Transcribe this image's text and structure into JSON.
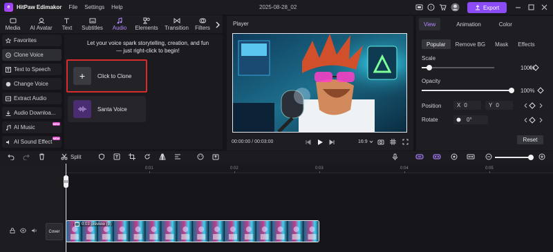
{
  "app": {
    "name": "HitPaw Edimakor",
    "logo_text": "e",
    "project_name": "2025-08-28_02"
  },
  "menu": [
    "File",
    "Settings",
    "Help"
  ],
  "toolbar": {
    "export_label": "Export"
  },
  "media_tabs": [
    {
      "label": "Media",
      "icon": "media-icon",
      "active": false
    },
    {
      "label": "AI Avatar",
      "icon": "ai-avatar-icon",
      "active": false
    },
    {
      "label": "Text",
      "icon": "text-icon",
      "active": false
    },
    {
      "label": "Subtitles",
      "icon": "subtitles-icon",
      "active": false
    },
    {
      "label": "Audio",
      "icon": "music-note-icon",
      "active": true
    },
    {
      "label": "Elements",
      "icon": "elements-icon",
      "active": false
    },
    {
      "label": "Transition",
      "icon": "transition-icon",
      "active": false
    },
    {
      "label": "Filters",
      "icon": "filters-icon",
      "active": false
    }
  ],
  "left_nav": [
    {
      "label": "Favorites",
      "icon": "star-icon",
      "active": false,
      "badge": ""
    },
    {
      "label": "Clone Voice",
      "icon": "clone-voice-icon",
      "active": true,
      "badge": ""
    },
    {
      "label": "Text to Speech",
      "icon": "text-to-speech-icon",
      "active": false,
      "badge": ""
    },
    {
      "label": "Change Voice",
      "icon": "change-voice-icon",
      "active": false,
      "badge": ""
    },
    {
      "label": "Extract Audio",
      "icon": "extract-audio-icon",
      "active": false,
      "badge": ""
    },
    {
      "label": "Audio Downloa...",
      "icon": "download-icon",
      "active": false,
      "badge": ""
    },
    {
      "label": "AI Music",
      "icon": "ai-music-icon",
      "active": false,
      "badge": "NEW"
    },
    {
      "label": "AI Sound Effect",
      "icon": "sound-effect-icon",
      "active": false,
      "badge": "NEW"
    }
  ],
  "clone_panel": {
    "intro_line1": "Let your voice spark storytelling, creation, and fun",
    "intro_line2": "— just right-click to begin!",
    "clone_card_label": "Click to Clone",
    "voices": [
      {
        "label": "Santa Voice"
      }
    ]
  },
  "player": {
    "title": "Player",
    "time_current": "00:00:00",
    "time_separator": "/",
    "time_total": "00:03:00",
    "aspect_ratio": "16:9"
  },
  "props": {
    "tabs": [
      {
        "label": "View",
        "active": true
      },
      {
        "label": "Animation",
        "active": false
      },
      {
        "label": "Color",
        "active": false
      }
    ],
    "subtabs": [
      {
        "label": "Popular",
        "active": true
      },
      {
        "label": "Remove BG",
        "active": false
      },
      {
        "label": "Mask",
        "active": false
      },
      {
        "label": "Effects",
        "active": false
      }
    ],
    "scale": {
      "label": "Scale",
      "value": "100%",
      "level": 0.1
    },
    "opacity": {
      "label": "Opacity",
      "value": "100%",
      "level": 1.0
    },
    "position": {
      "label": "Position",
      "x_label": "X",
      "x_value": "0",
      "y_label": "Y",
      "y_value": "0"
    },
    "rotate": {
      "label": "Rotate",
      "value": "0°"
    },
    "reset_label": "Reset"
  },
  "timeline_toolbar": {
    "split_label": "Split"
  },
  "timeline": {
    "ruler_ticks": [
      "0:01",
      "0:02",
      "0:03",
      "0:04",
      "0:05"
    ],
    "cover_label": "Cover",
    "clip_label": "0:03 preview (9)"
  },
  "colors": {
    "accent": "#8c4cf5",
    "highlight_border": "#d92b2b",
    "active_tab_text": "#b68cff"
  }
}
